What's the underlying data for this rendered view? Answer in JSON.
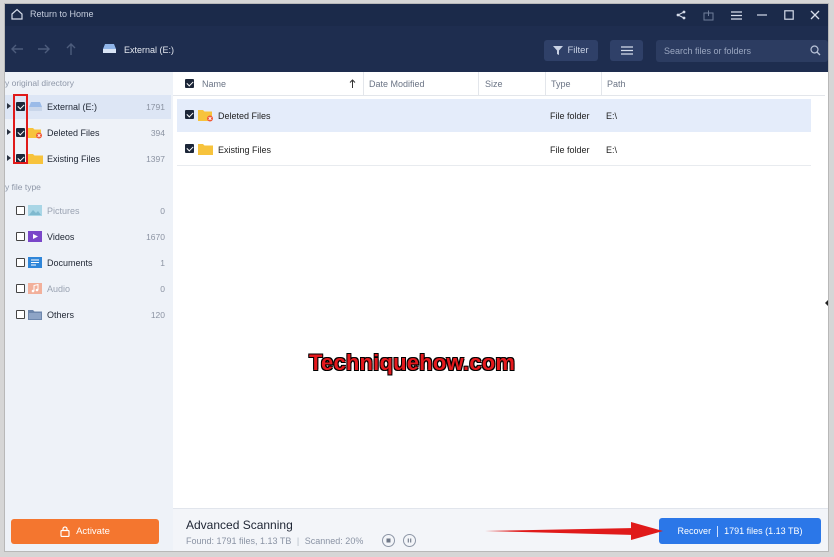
{
  "titlebar": {
    "title": "Return to Home"
  },
  "toolbar": {
    "breadcrumb": "External (E:)",
    "filter_label": "Filter",
    "search_placeholder": "Search files or folders"
  },
  "sidebar": {
    "section_directory": "y original directory",
    "section_filetype": "y file type",
    "directory_items": [
      {
        "label": "External (E:)",
        "count": "1791",
        "checked": true
      },
      {
        "label": "Deleted Files",
        "count": "394",
        "checked": true
      },
      {
        "label": "Existing Files",
        "count": "1397",
        "checked": true
      }
    ],
    "type_items": [
      {
        "label": "Pictures",
        "count": "0",
        "muted": true
      },
      {
        "label": "Videos",
        "count": "1670",
        "muted": false
      },
      {
        "label": "Documents",
        "count": "1",
        "muted": false
      },
      {
        "label": "Audio",
        "count": "0",
        "muted": true
      },
      {
        "label": "Others",
        "count": "120",
        "muted": false
      }
    ],
    "activate_label": "Activate"
  },
  "table": {
    "columns": {
      "name": "Name",
      "date_modified": "Date Modified",
      "size": "Size",
      "type": "Type",
      "path": "Path"
    },
    "rows": [
      {
        "name": "Deleted Files",
        "type": "File folder",
        "path": "E:\\"
      },
      {
        "name": "Existing Files",
        "type": "File folder",
        "path": "E:\\"
      }
    ]
  },
  "watermark": "Techniquehow.com",
  "bottom": {
    "scan_title": "Advanced Scanning",
    "found_text": "Found: 1791 files, 1.13 TB",
    "scanned_text": "Scanned: 20%",
    "recover_label": "Recover",
    "recover_detail": "1791 files (1.13 TB)"
  },
  "colors": {
    "titlebar": "#1b2a4a",
    "toolbar": "#1e2d4f",
    "accent_blue": "#2b77e8",
    "activate_orange": "#f4762f",
    "highlight_red": "#e01a1a"
  }
}
